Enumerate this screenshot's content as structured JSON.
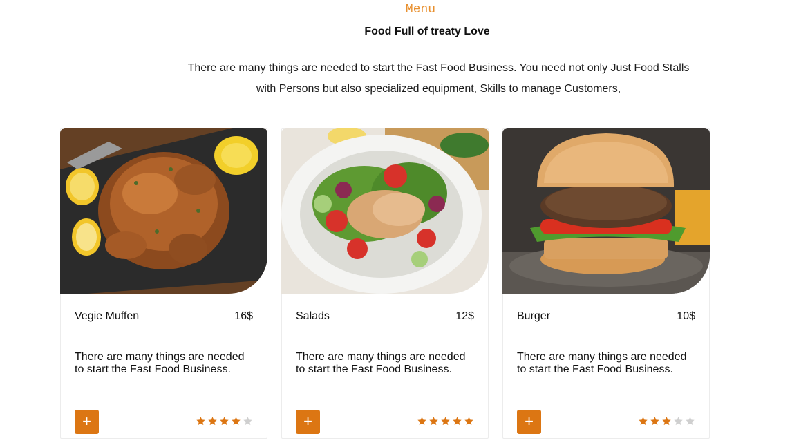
{
  "section": {
    "eyebrow": "Menu",
    "headline": "Food Full of treaty Love",
    "intro": "There are many things are needed to start the Fast Food Business. You need not only Just Food Stalls with Persons but also specialized equipment, Skills to manage Customers,"
  },
  "colors": {
    "accent": "#dc7613",
    "eyebrow": "#e8902f",
    "star_on": "#dc7613",
    "star_off": "#cfcfcf"
  },
  "cards": [
    {
      "name": "Vegie Muffen",
      "price": "16$",
      "description": "There are many things are needed to start the Fast Food Business.",
      "add_label": "+",
      "rating": 4,
      "rating_max": 5,
      "image": "roast-chicken-photo"
    },
    {
      "name": "Salads",
      "price": "12$",
      "description": "There are many things are needed to start the Fast Food Business.",
      "add_label": "+",
      "rating": 5,
      "rating_max": 5,
      "image": "chicken-salad-photo"
    },
    {
      "name": "Burger",
      "price": "10$",
      "description": "There are many things are needed to start the Fast Food Business.",
      "add_label": "+",
      "rating": 3,
      "rating_max": 5,
      "image": "veggie-burger-photo"
    }
  ]
}
